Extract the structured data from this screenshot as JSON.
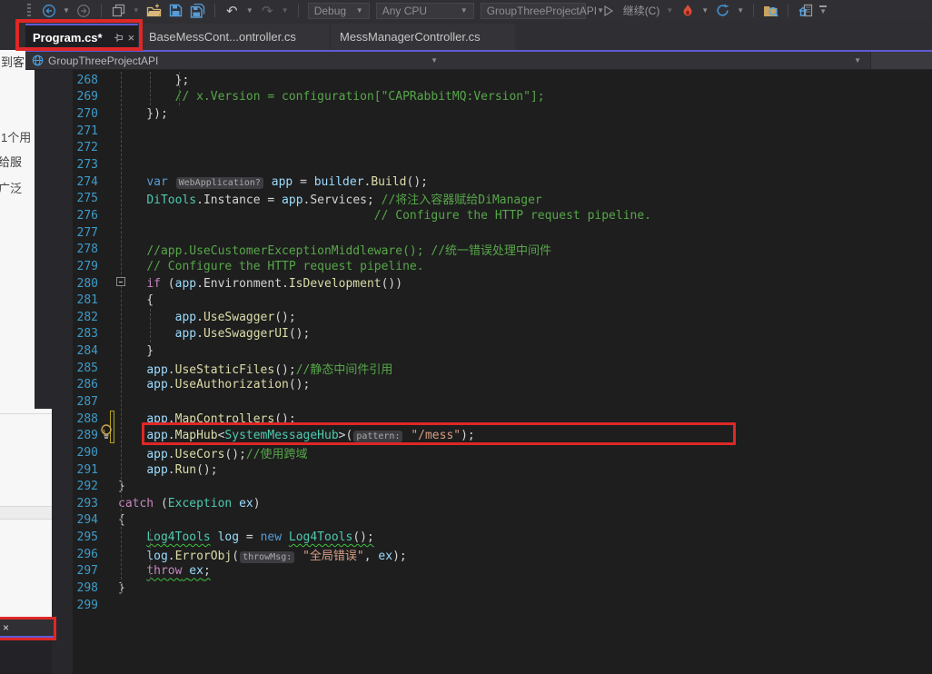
{
  "toolbar": {
    "config": "Debug",
    "platform": "Any CPU",
    "startup_project": "GroupThreeProjectAPI",
    "continue_label": "继续(C)",
    "icons": [
      "back",
      "forward",
      "new-window",
      "open-folder",
      "save",
      "save-all",
      "undo",
      "redo",
      "start",
      "hot-reload",
      "restart",
      "find-in-files",
      "solution-explorer",
      "toolbar-overflow"
    ]
  },
  "tabs": [
    {
      "label": "Program.cs*",
      "active": true
    },
    {
      "label": "BaseMessCont...ontroller.cs",
      "active": false
    },
    {
      "label": "MessManagerController.cs",
      "active": false
    }
  ],
  "navbar": {
    "project": "GroupThreeProjectAPI"
  },
  "background_window": {
    "fragment_top": "到客",
    "fragments": [
      "1个用",
      "给服",
      "广泛"
    ]
  },
  "editor": {
    "lines": [
      {
        "n": 268,
        "segs": [
          {
            "t": "        };",
            "c": "pun"
          }
        ]
      },
      {
        "n": 269,
        "segs": [
          {
            "t": "        ",
            "c": "pun"
          },
          {
            "t": "// x.Version = configuration[\"CAPRabbitMQ:Version\"];",
            "c": "com"
          }
        ]
      },
      {
        "n": 270,
        "segs": [
          {
            "t": "    });",
            "c": "pun"
          }
        ]
      },
      {
        "n": 271,
        "segs": []
      },
      {
        "n": 272,
        "segs": []
      },
      {
        "n": 273,
        "segs": []
      },
      {
        "n": 274,
        "segs": [
          {
            "t": "    ",
            "c": "pun"
          },
          {
            "t": "var",
            "c": "kw"
          },
          {
            "t": " ",
            "c": "pun"
          },
          {
            "t": "WebApplication?",
            "c": "hint"
          },
          {
            "t": " ",
            "c": "pun"
          },
          {
            "t": "app",
            "c": "loc"
          },
          {
            "t": " = ",
            "c": "pun"
          },
          {
            "t": "builder",
            "c": "loc"
          },
          {
            "t": ".",
            "c": "pun"
          },
          {
            "t": "Build",
            "c": "met"
          },
          {
            "t": "();",
            "c": "pun"
          }
        ]
      },
      {
        "n": 275,
        "segs": [
          {
            "t": "    ",
            "c": "pun"
          },
          {
            "t": "DiTools",
            "c": "typ"
          },
          {
            "t": ".",
            "c": "pun"
          },
          {
            "t": "Instance",
            "c": "pln"
          },
          {
            "t": " = ",
            "c": "pun"
          },
          {
            "t": "app",
            "c": "loc"
          },
          {
            "t": ".",
            "c": "pun"
          },
          {
            "t": "Services",
            "c": "pln"
          },
          {
            "t": "; ",
            "c": "pun"
          },
          {
            "t": "//将注入容器赋给DiManager",
            "c": "com"
          }
        ]
      },
      {
        "n": 276,
        "segs": [
          {
            "t": "                                    ",
            "c": "pun"
          },
          {
            "t": "// Configure the HTTP request pipeline.",
            "c": "com"
          }
        ]
      },
      {
        "n": 277,
        "segs": []
      },
      {
        "n": 278,
        "segs": [
          {
            "t": "    ",
            "c": "pun"
          },
          {
            "t": "//app.UseCustomerExceptionMiddleware(); //统一错误处理中间件",
            "c": "com"
          }
        ]
      },
      {
        "n": 279,
        "segs": [
          {
            "t": "    ",
            "c": "pun"
          },
          {
            "t": "// Configure the HTTP request pipeline.",
            "c": "com"
          }
        ]
      },
      {
        "n": 280,
        "segs": [
          {
            "t": "    ",
            "c": "pun"
          },
          {
            "t": "if",
            "c": "ctl"
          },
          {
            "t": " (",
            "c": "pun"
          },
          {
            "t": "app",
            "c": "loc"
          },
          {
            "t": ".",
            "c": "pun"
          },
          {
            "t": "Environment",
            "c": "pln"
          },
          {
            "t": ".",
            "c": "pun"
          },
          {
            "t": "IsDevelopment",
            "c": "met"
          },
          {
            "t": "())",
            "c": "pun"
          }
        ]
      },
      {
        "n": 281,
        "segs": [
          {
            "t": "    {",
            "c": "pun"
          }
        ]
      },
      {
        "n": 282,
        "segs": [
          {
            "t": "        ",
            "c": "pun"
          },
          {
            "t": "app",
            "c": "loc"
          },
          {
            "t": ".",
            "c": "pun"
          },
          {
            "t": "UseSwagger",
            "c": "met"
          },
          {
            "t": "();",
            "c": "pun"
          }
        ]
      },
      {
        "n": 283,
        "segs": [
          {
            "t": "        ",
            "c": "pun"
          },
          {
            "t": "app",
            "c": "loc"
          },
          {
            "t": ".",
            "c": "pun"
          },
          {
            "t": "UseSwaggerUI",
            "c": "met"
          },
          {
            "t": "();",
            "c": "pun"
          }
        ]
      },
      {
        "n": 284,
        "segs": [
          {
            "t": "    }",
            "c": "pun"
          }
        ]
      },
      {
        "n": 285,
        "segs": [
          {
            "t": "    ",
            "c": "pun"
          },
          {
            "t": "app",
            "c": "loc"
          },
          {
            "t": ".",
            "c": "pun"
          },
          {
            "t": "UseStaticFiles",
            "c": "met"
          },
          {
            "t": "();",
            "c": "pun"
          },
          {
            "t": "//静态中间件引用",
            "c": "com"
          }
        ]
      },
      {
        "n": 286,
        "segs": [
          {
            "t": "    ",
            "c": "pun"
          },
          {
            "t": "app",
            "c": "loc"
          },
          {
            "t": ".",
            "c": "pun"
          },
          {
            "t": "UseAuthorization",
            "c": "met"
          },
          {
            "t": "();",
            "c": "pun"
          }
        ]
      },
      {
        "n": 287,
        "segs": []
      },
      {
        "n": 288,
        "segs": [
          {
            "t": "    ",
            "c": "pun"
          },
          {
            "t": "app",
            "c": "loc"
          },
          {
            "t": ".",
            "c": "pun"
          },
          {
            "t": "MapControllers",
            "c": "met"
          },
          {
            "t": "();",
            "c": "pun"
          }
        ]
      },
      {
        "n": 289,
        "segs": [
          {
            "t": "    ",
            "c": "pun"
          },
          {
            "t": "app",
            "c": "loc"
          },
          {
            "t": ".",
            "c": "pun"
          },
          {
            "t": "MapHub",
            "c": "met"
          },
          {
            "t": "<",
            "c": "pun"
          },
          {
            "t": "SystemMessageHub",
            "c": "typ"
          },
          {
            "t": ">(",
            "c": "pun"
          },
          {
            "t": "pattern:",
            "c": "hint"
          },
          {
            "t": " ",
            "c": "pun"
          },
          {
            "t": "\"/mess\"",
            "c": "str"
          },
          {
            "t": ");",
            "c": "pun"
          }
        ]
      },
      {
        "n": 290,
        "segs": [
          {
            "t": "    ",
            "c": "pun"
          },
          {
            "t": "app",
            "c": "loc"
          },
          {
            "t": ".",
            "c": "pun"
          },
          {
            "t": "UseCors",
            "c": "met"
          },
          {
            "t": "();",
            "c": "pun"
          },
          {
            "t": "//使用跨域",
            "c": "com"
          }
        ]
      },
      {
        "n": 291,
        "segs": [
          {
            "t": "    ",
            "c": "pun"
          },
          {
            "t": "app",
            "c": "loc"
          },
          {
            "t": ".",
            "c": "pun"
          },
          {
            "t": "Run",
            "c": "met"
          },
          {
            "t": "();",
            "c": "pun"
          }
        ]
      },
      {
        "n": 292,
        "segs": [
          {
            "t": "}",
            "c": "pun"
          }
        ]
      },
      {
        "n": 293,
        "segs": [
          {
            "t": "catch",
            "c": "ctl"
          },
          {
            "t": " (",
            "c": "pun"
          },
          {
            "t": "Exception",
            "c": "typ"
          },
          {
            "t": " ",
            "c": "pun"
          },
          {
            "t": "ex",
            "c": "loc"
          },
          {
            "t": ")",
            "c": "pun"
          }
        ]
      },
      {
        "n": 294,
        "segs": [
          {
            "t": "{",
            "c": "pun"
          }
        ]
      },
      {
        "n": 295,
        "segs": [
          {
            "t": "    ",
            "c": "pun"
          },
          {
            "t": "Log4Tools",
            "c": "typ",
            "u": 1
          },
          {
            "t": " ",
            "c": "pun"
          },
          {
            "t": "log",
            "c": "loc"
          },
          {
            "t": " = ",
            "c": "pun"
          },
          {
            "t": "new",
            "c": "kw"
          },
          {
            "t": " ",
            "c": "pun"
          },
          {
            "t": "Log4Tools",
            "c": "typ",
            "u": 1
          },
          {
            "t": "();",
            "c": "pun",
            "u": 1
          }
        ]
      },
      {
        "n": 296,
        "segs": [
          {
            "t": "    ",
            "c": "pun"
          },
          {
            "t": "log",
            "c": "loc"
          },
          {
            "t": ".",
            "c": "pun"
          },
          {
            "t": "ErrorObj",
            "c": "met"
          },
          {
            "t": "(",
            "c": "pun"
          },
          {
            "t": "throwMsg:",
            "c": "hint"
          },
          {
            "t": " ",
            "c": "pun"
          },
          {
            "t": "\"全局错误\"",
            "c": "str"
          },
          {
            "t": ", ",
            "c": "pun"
          },
          {
            "t": "ex",
            "c": "loc"
          },
          {
            "t": ");",
            "c": "pun"
          }
        ]
      },
      {
        "n": 297,
        "segs": [
          {
            "t": "    ",
            "c": "pun"
          },
          {
            "t": "throw",
            "c": "ctl",
            "u": 1
          },
          {
            "t": " ",
            "c": "pun",
            "u": 1
          },
          {
            "t": "ex",
            "c": "loc",
            "u": 1
          },
          {
            "t": ";",
            "c": "pun",
            "u": 1
          }
        ]
      },
      {
        "n": 298,
        "segs": [
          {
            "t": "}",
            "c": "pun"
          }
        ]
      },
      {
        "n": 299,
        "segs": []
      }
    ]
  }
}
